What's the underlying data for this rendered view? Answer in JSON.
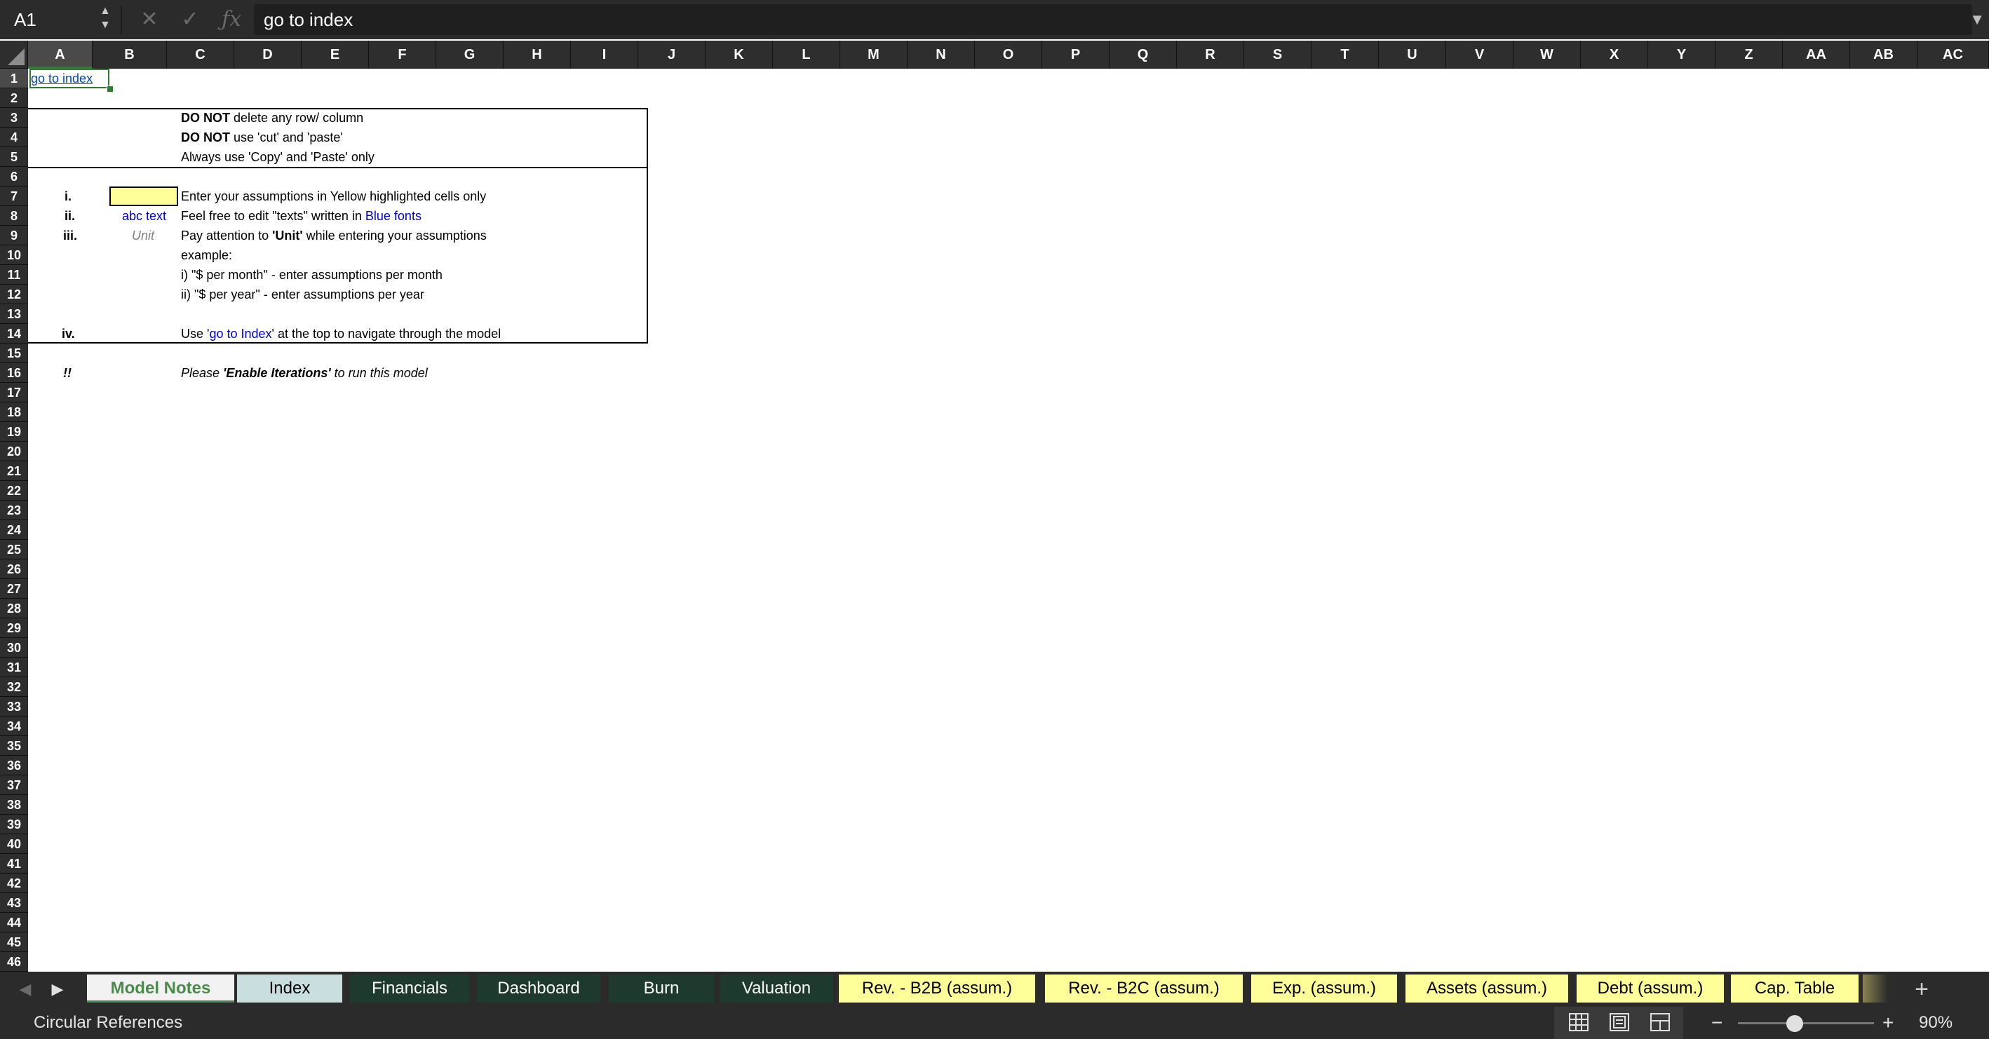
{
  "formula_bar": {
    "name_box": "A1",
    "cancel_icon": "close-icon",
    "enter_icon": "checkmark-icon",
    "function_icon": "fx-icon",
    "formula": "go to index"
  },
  "columns": [
    "A",
    "B",
    "C",
    "D",
    "E",
    "F",
    "G",
    "H",
    "I",
    "J",
    "K",
    "L",
    "M",
    "N",
    "O",
    "P",
    "Q",
    "R",
    "S",
    "T",
    "U",
    "V",
    "W",
    "X",
    "Y",
    "Z",
    "AA",
    "AB",
    "AC"
  ],
  "selected_column": "A",
  "rows": [
    "1",
    "2",
    "3",
    "4",
    "5",
    "6",
    "7",
    "8",
    "9",
    "10",
    "11",
    "12",
    "13",
    "14",
    "15",
    "16",
    "17",
    "18",
    "19",
    "20",
    "21",
    "22",
    "23",
    "24",
    "25",
    "26",
    "27",
    "28",
    "29",
    "30",
    "31",
    "32",
    "33",
    "34",
    "35",
    "36",
    "37",
    "38",
    "39",
    "40",
    "41",
    "42",
    "43",
    "44",
    "45",
    "46"
  ],
  "selected_row": "1",
  "cells": {
    "a1": "go to index",
    "note1_bold": "DO NOT",
    "note1_rest": " delete any row/ column",
    "note2_bold": "DO NOT",
    "note2_rest": " use 'cut' and 'paste'",
    "note3": "Always use 'Copy' and 'Paste' only",
    "r7_num": "i.",
    "r7_text": "Enter your assumptions in Yellow highlighted cells only",
    "r8_num": "ii.",
    "r8_example": "abc text",
    "r8_text_a": "Feel free to edit \"texts\" written in ",
    "r8_text_b": "Blue fonts",
    "r9_num": "iii.",
    "r9_example": "Unit",
    "r9_text_a": "Pay attention to ",
    "r9_text_b": "'Unit'",
    "r9_text_c": " while entering your assumptions",
    "r10": "example:",
    "r11": "i)  \"$ per month\" - enter assumptions per month",
    "r12": "ii) \"$ per year\" - enter assumptions per year",
    "r14_num": "iv.",
    "r14_text_a": "Use '",
    "r14_text_b": "go to Index",
    "r14_text_c": "' at the top to navigate through the model",
    "r16_num": "!!",
    "r16_text_a": "Please  ",
    "r16_text_b": "'Enable Iterations'",
    "r16_text_c": "  to run this model"
  },
  "colors": {
    "link": "#0645ad",
    "blue_font": "#0000cc",
    "highlight": "#ffff99",
    "selection": "#2e7d32"
  },
  "tabs": [
    {
      "label": "Model Notes",
      "style": "active"
    },
    {
      "label": "Index",
      "style": "light"
    },
    {
      "label": "Financials",
      "style": "dark"
    },
    {
      "label": "Dashboard",
      "style": "dark"
    },
    {
      "label": "Burn",
      "style": "dark"
    },
    {
      "label": "Valuation",
      "style": "dark"
    },
    {
      "label": "Rev. - B2B (assum.)",
      "style": "yellow"
    },
    {
      "label": "Rev. - B2C (assum.)",
      "style": "yellow"
    },
    {
      "label": "Exp. (assum.)",
      "style": "yellow"
    },
    {
      "label": "Assets (assum.)",
      "style": "yellow"
    },
    {
      "label": "Debt (assum.)",
      "style": "yellow"
    },
    {
      "label": "Cap. Table",
      "style": "yellow"
    }
  ],
  "status_bar": {
    "status": "Circular References",
    "zoom": "90%",
    "zoom_fraction": 0.42
  }
}
